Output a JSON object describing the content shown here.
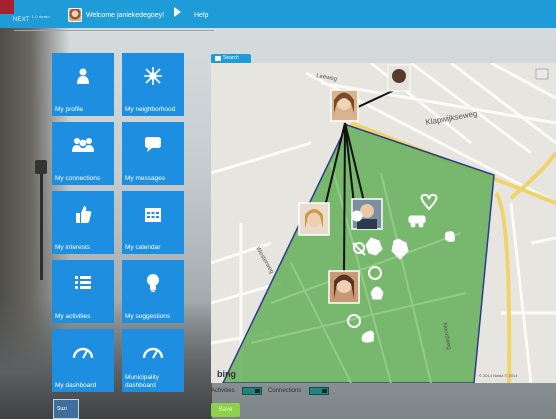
{
  "header": {
    "logo_text": "NEXT",
    "logo_sup": "1.0 demo",
    "welcome": "Welcome janiekedegoey!",
    "help": "Help"
  },
  "tiles": [
    {
      "label": "My profile",
      "icon": "person-icon"
    },
    {
      "label": "My neighborhood",
      "icon": "neighborhood-icon"
    },
    {
      "label": "My connections",
      "icon": "people-icon"
    },
    {
      "label": "My messages",
      "icon": "speech-bubble-icon"
    },
    {
      "label": "My interests",
      "icon": "thumbs-up-icon"
    },
    {
      "label": "My calendar",
      "icon": "calendar-icon"
    },
    {
      "label": "My activities",
      "icon": "list-icon"
    },
    {
      "label": "My suggestions",
      "icon": "lightbulb-icon"
    },
    {
      "label": "My dashboard",
      "icon": "gauge-icon"
    },
    {
      "label": "Municipality dashboard",
      "icon": "gauge-icon"
    }
  ],
  "map": {
    "search_label": "Search",
    "streets": [
      "Leeweg",
      "Klapwijkseweg",
      "Westerweg",
      "Burg. de Raadtsingel",
      "Noordweg"
    ],
    "attribution": "© 2014 Nokia   © 2014",
    "bing": "bing",
    "area_color": "#64b05a"
  },
  "controls": {
    "activities": "Activities",
    "connections": "Connections",
    "save": "Save"
  },
  "footer": {
    "avatar_text": "Suzi"
  }
}
